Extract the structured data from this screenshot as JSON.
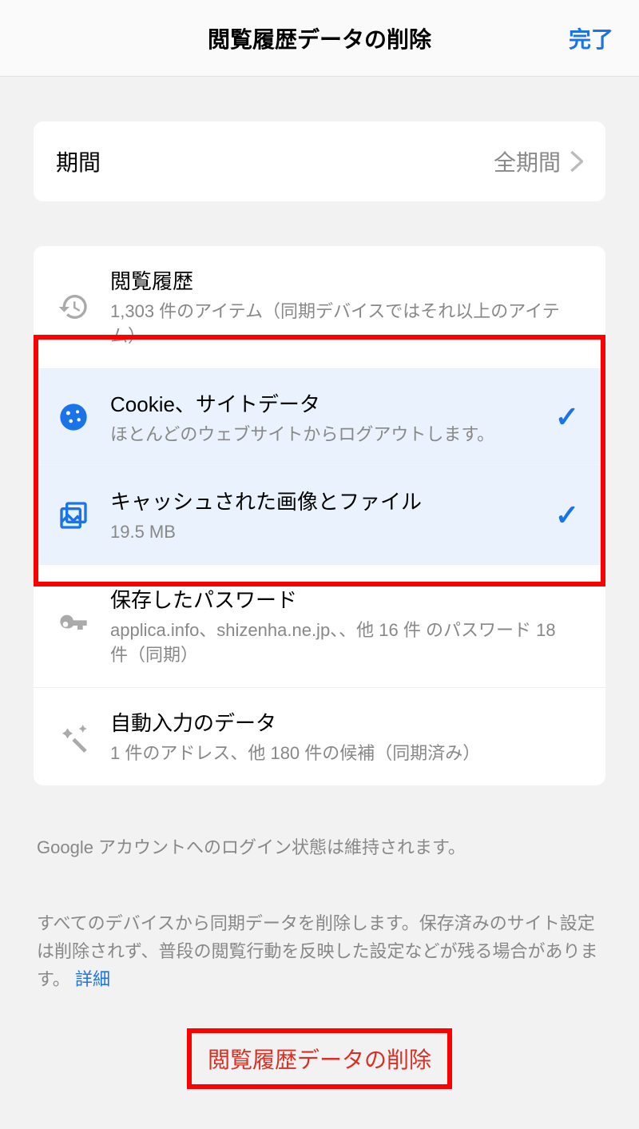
{
  "header": {
    "title": "閲覧履歴データの削除",
    "done": "完了"
  },
  "timeRange": {
    "label": "期間",
    "value": "全期間"
  },
  "options": {
    "history": {
      "title": "閲覧履歴",
      "sub": "1,303 件のアイテム（同期デバイスではそれ以上のアイテム）"
    },
    "cookies": {
      "title": "Cookie、サイトデータ",
      "sub": "ほとんどのウェブサイトからログアウトします。"
    },
    "cache": {
      "title": "キャッシュされた画像とファイル",
      "sub": "19.5 MB"
    },
    "passwords": {
      "title": "保存したパスワード",
      "sub": "applica.info、shizenha.ne.jp、、他 16 件 のパスワード 18 件（同期）"
    },
    "autofill": {
      "title": "自動入力のデータ",
      "sub": "1 件のアドレス、他 180 件の候補（同期済み）"
    }
  },
  "notes": {
    "account": "Google アカウントへのログイン状態は維持されます。",
    "sync": "すべてのデバイスから同期データを削除します。保存済みのサイト設定は削除されず、普段の閲覧行動を反映した設定などが残る場合があります。",
    "details": "詳細"
  },
  "deleteBtn": "閲覧履歴データの削除"
}
